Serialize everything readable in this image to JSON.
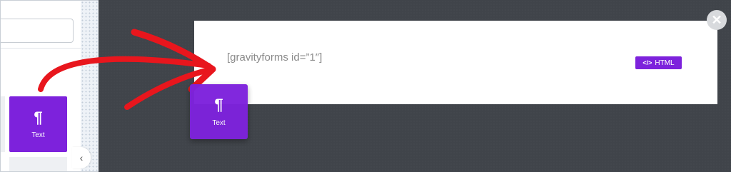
{
  "left_panel": {
    "search": {
      "placeholder": ""
    },
    "widget_tile": {
      "icon": "pilcrow-icon",
      "glyph": "¶",
      "label": "Text"
    }
  },
  "collapse_toggle": {
    "glyph": "‹"
  },
  "canvas": {
    "content": {
      "shortcode": "[gravityforms id=”1″]"
    },
    "html_badge": {
      "icon_glyph": "</>",
      "label": "HTML"
    },
    "close_glyph": "✕",
    "dragging_widget": {
      "glyph": "¶",
      "label": "Text"
    }
  },
  "colors": {
    "accent": "#7d22dc",
    "canvas_bg": "#40444a",
    "arrow": "#e8161d"
  }
}
